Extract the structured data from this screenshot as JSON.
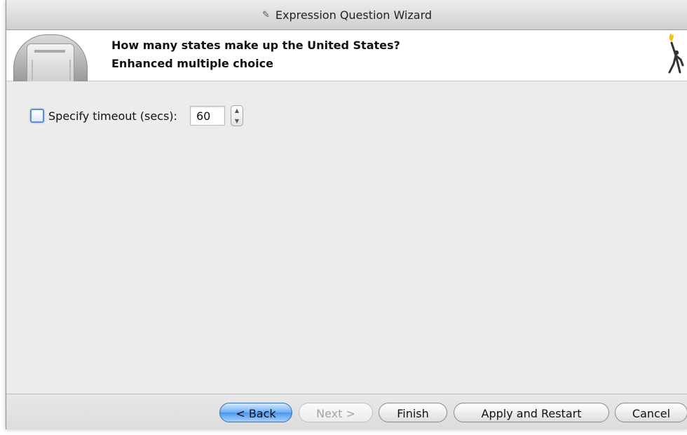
{
  "window": {
    "title": "Expression Question Wizard",
    "title_icon": "wand-icon"
  },
  "header": {
    "title": "How many states make up the United States?",
    "subtitle": "Enhanced multiple choice",
    "image_icon": "question-machine-icon",
    "logo_icon": "torch-figure-icon"
  },
  "timeout": {
    "checked": false,
    "label": "Specify timeout (secs):",
    "value": "60"
  },
  "buttons": {
    "back": "< Back",
    "next": "Next >",
    "finish": "Finish",
    "apply_restart": "Apply and Restart",
    "cancel": "Cancel"
  },
  "colors": {
    "accent": "#5b8fd6",
    "default_button": "#4c97ea",
    "logo_flame": "#f5c000"
  }
}
